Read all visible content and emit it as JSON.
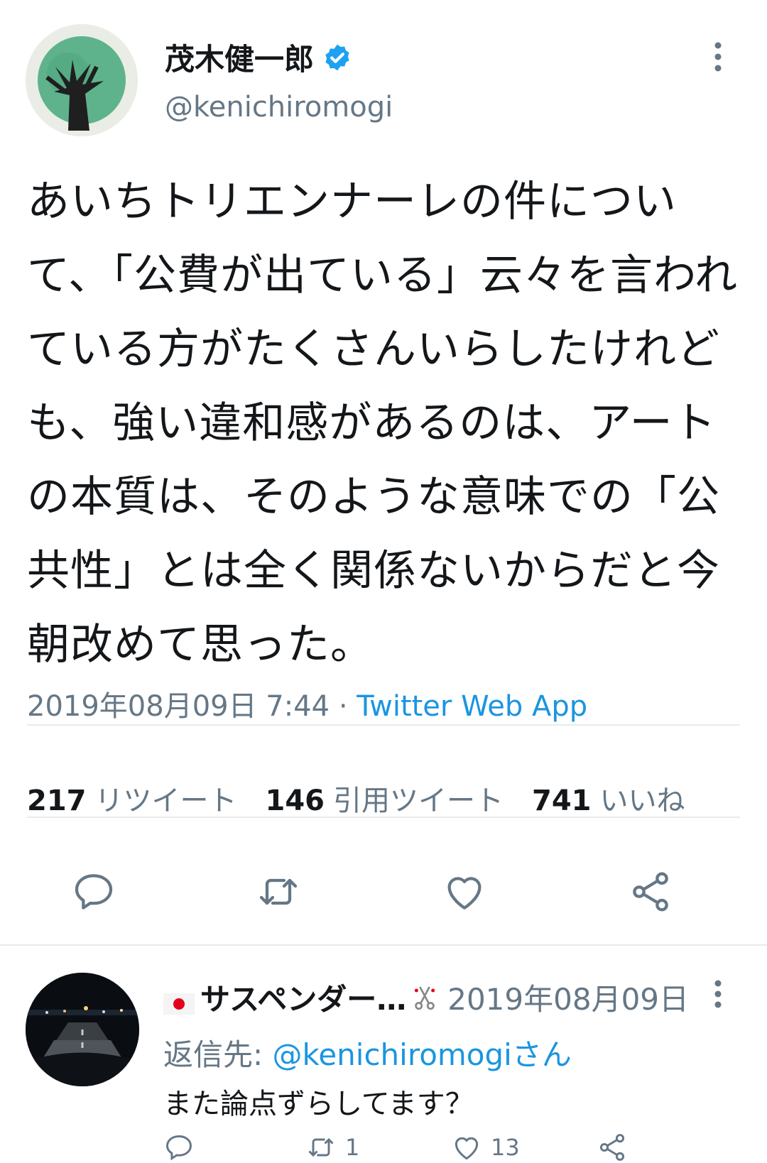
{
  "tweet": {
    "author_name": "茂木健一郎",
    "author_handle": "@kenichiromogi",
    "text": "あいちトリエンナーレの件について、「公費が出ている」云々を言われている方がたくさんいらしたけれども、強い違和感があるのは、アートの本質は、そのような意味での「公共性」とは全く関係ないからだと今朝改めて思った。",
    "date": "2019年08月09日 7:44",
    "separator": "·",
    "source": "Twitter Web App",
    "stats": [
      {
        "count": "217",
        "label": "リツイート"
      },
      {
        "count": "146",
        "label": "引用ツイート"
      },
      {
        "count": "741",
        "label": "いいね"
      }
    ]
  },
  "reply": {
    "name": "サスペンダー…",
    "date": "2019年08月09日",
    "reply_to_label": "返信先:",
    "reply_to_handle": "@kenichiromogiさん",
    "text": "また論点ずらしてます？",
    "retweets": "1",
    "likes": "13"
  },
  "colors": {
    "text": "#14171a",
    "secondary": "#657786",
    "link": "#1b95e0",
    "verified": "#1da1f2",
    "divider": "#e6ecf0"
  },
  "icons": [
    "verified-badge-icon",
    "more-icon",
    "reply-icon",
    "retweet-icon",
    "like-icon",
    "share-icon",
    "japan-flag-icon",
    "scissors-icon"
  ]
}
